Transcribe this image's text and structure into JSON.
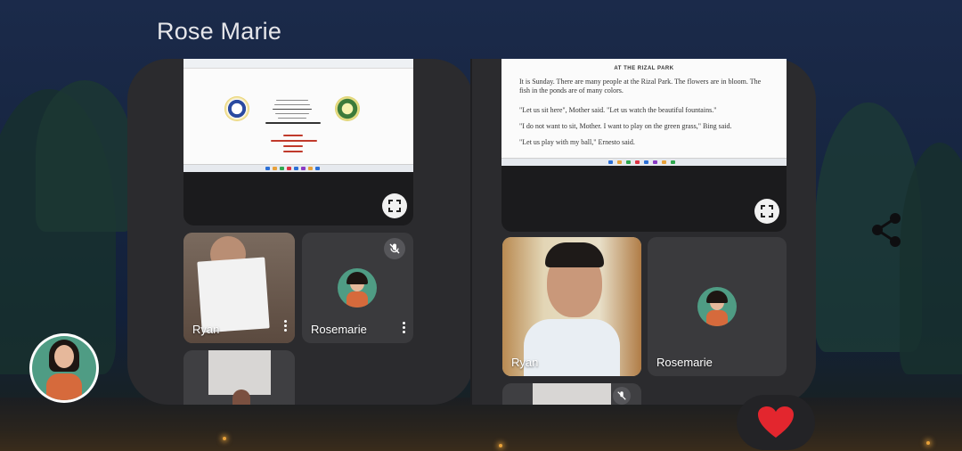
{
  "header": {
    "title": "Rose Marie"
  },
  "left_panel": {
    "shared_screen": {
      "doc_lines": [
        "Republic of the Philippines",
        "Department of Education",
        "Region VI-CALABARZON",
        "Division of Cavite City",
        "District II",
        "BAGANBINDA ELEMENTARY SCHOOL",
        "QUARTER 1",
        "READING INTERVENTION",
        "WEEK 3-4",
        "FILIPINO"
      ]
    },
    "participants": [
      {
        "name": "Ryan"
      },
      {
        "name": "Rosemarie"
      }
    ]
  },
  "right_panel": {
    "shared_screen": {
      "heading": "AT THE RIZAL PARK",
      "paragraphs": [
        "It is Sunday. There are many people at the Rizal Park. The flowers are in bloom. The fish in the ponds are of many colors.",
        "\"Let us sit here\", Mother said. \"Let us watch the beautiful fountains.\"",
        "\"I do not want to sit, Mother. I want to play on the green grass,\" Bing said.",
        "\"Let us play with my ball,\" Ernesto said."
      ]
    },
    "participants": [
      {
        "name": "Ryan"
      },
      {
        "name": "Rosemarie"
      }
    ]
  },
  "icons": {
    "fullscreen": "fullscreen-icon",
    "share": "share-icon",
    "mic_off": "mic-off-icon",
    "more": "more-vert-icon",
    "heart": "heart-icon"
  },
  "colors": {
    "panel": "#2b2b2e",
    "tile": "#3a3a3d",
    "heart": "#e3262e",
    "avatar_bg": "#4f9c84"
  }
}
